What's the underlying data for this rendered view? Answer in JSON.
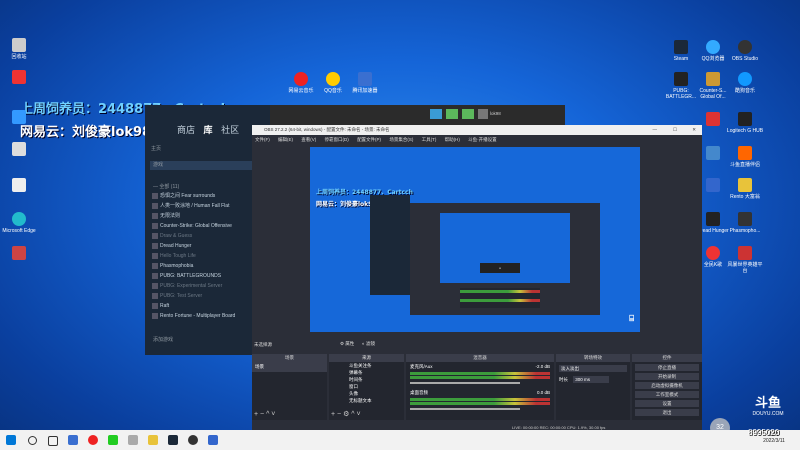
{
  "overlay": {
    "line1": "上周饲养员：2448877、Cartcch",
    "line2": "网易云：刘俊豪lok98"
  },
  "desktop_icons_left": [
    "回收站",
    "",
    "",
    "Microsoft Edge",
    "",
    "",
    ""
  ],
  "desktop_icons_top": [
    "网易云音乐",
    "QQ音乐",
    "腾讯加速器"
  ],
  "desktop_icons_right": [
    [
      "Steam",
      "QQ浏览器",
      "OBS Studio"
    ],
    [
      "PUBG: BATTLEGR...",
      "Counter-S... Global Of...",
      "酷狗音乐"
    ],
    [
      "",
      "Logitech G HUB"
    ],
    [
      "",
      "",
      "斗鱼直播伴侣"
    ],
    [
      "",
      "Rento 大富翁"
    ],
    [
      "Dread Hunger",
      "Phasmopho..."
    ],
    [
      "全民K歌",
      "风暴世界英雄平台"
    ]
  ],
  "steam": {
    "nav": [
      "商店",
      "库",
      "社区"
    ],
    "home": "主页",
    "search_placeholder": "游戏",
    "section": "— 全部 (11)",
    "games": [
      {
        "name": "恐惧之间 Fear surrounds",
        "dim": false
      },
      {
        "name": "人类一败涂地 / Human Fall Flat",
        "dim": false
      },
      {
        "name": "无限法则",
        "dim": false
      },
      {
        "name": "Counter-Strike: Global Offensive",
        "dim": false
      },
      {
        "name": "Draw & Guess",
        "dim": true
      },
      {
        "name": "Dread Hunger",
        "dim": false
      },
      {
        "name": "Hello Tough Life",
        "dim": true
      },
      {
        "name": "Phasmophobia",
        "dim": false
      },
      {
        "name": "PUBG: BATTLEGROUNDS",
        "dim": false
      },
      {
        "name": "PUBG: Experimental Server",
        "dim": true
      },
      {
        "name": "PUBG: Test Server",
        "dim": true
      },
      {
        "name": "Raft",
        "dim": false
      },
      {
        "name": "Rento Fortune - Multiplayer Board",
        "dim": false
      }
    ],
    "add_game": "添加游戏"
  },
  "obs": {
    "title": "OBS 27.2.2 (64-bit, windows) - 配置文件: 未命名 - 场景: 未命名",
    "user": "lok98",
    "menu": [
      "文件(F)",
      "编辑(E)",
      "查看(V)",
      "停靠窗口(D)",
      "配置文件(P)",
      "场景集合(S)",
      "工具(T)",
      "帮助(H)",
      "斗鱼·开播设置"
    ],
    "status_badge": "未选择源",
    "panels": {
      "scenes": "场景",
      "sources": "来源",
      "mixer": "混音器",
      "transitions": "转场特效",
      "controls": "控件"
    },
    "props_btn": "属性",
    "filter_btn": "滤镜",
    "scene_items": [
      "场景"
    ],
    "source_items": [
      "斗鱼关注条",
      "弹幕条",
      "时间条",
      "窗口",
      "头像",
      "无标题文本"
    ],
    "mixer": [
      {
        "name": "麦克风/Aux",
        "db": "-2.0 dB"
      },
      {
        "name": "桌面音频",
        "db": "0.0 dB"
      }
    ],
    "transition_name": "淡入淡出",
    "duration_label": "时长",
    "duration": "300 ms",
    "controls": [
      "停止直播",
      "开始录制",
      "启动虚拟摄像机",
      "工作室模式",
      "设置",
      "退出"
    ],
    "status": "LIVE: 00:00:00   REC: 00:00:00   CPU: 1.9%, 30.00 fps"
  },
  "douyu": {
    "logo": "斗鱼",
    "sub": "DOUYU.COM",
    "room": "8995020"
  },
  "taskbar": {
    "time": "0:31",
    "date": "2022/3/11",
    "volume_badge": "32"
  }
}
